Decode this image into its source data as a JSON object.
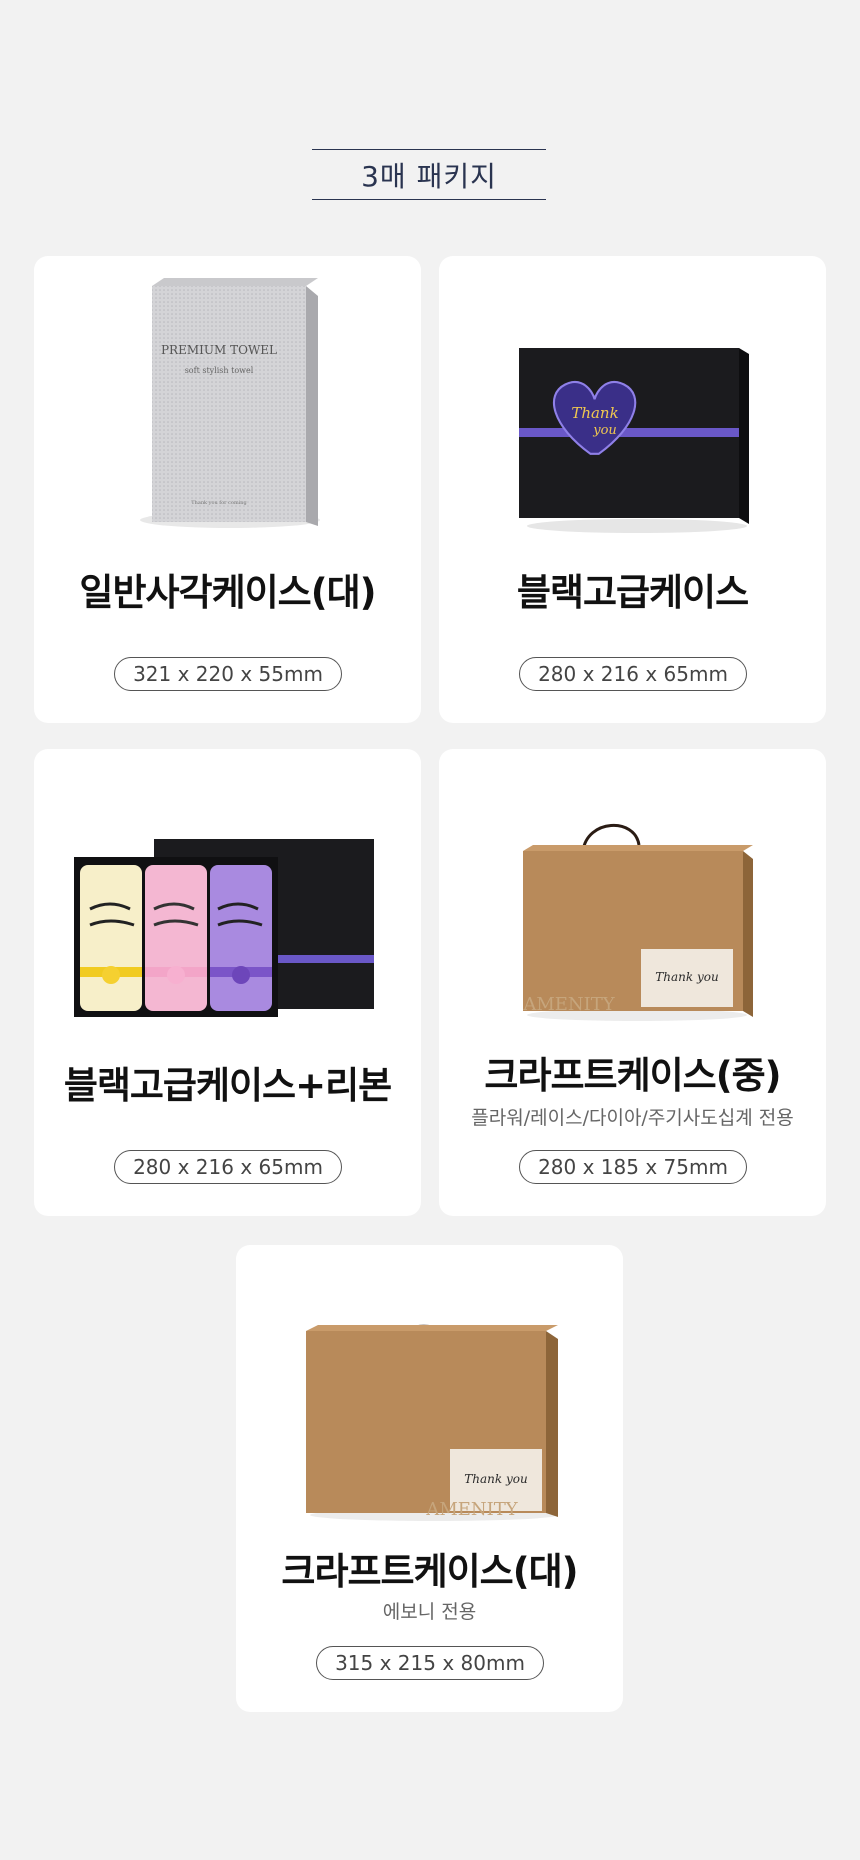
{
  "header": {
    "title": "3매 패키지"
  },
  "cards": [
    {
      "title": "일반사각케이스(대)",
      "subtitle": "",
      "size": "321 x 220 x 55mm",
      "image_text": {
        "line1": "PREMIUM TOWEL",
        "line2": "soft stylish towel",
        "line3": "Thank you for coming"
      }
    },
    {
      "title": "블랙고급케이스",
      "subtitle": "",
      "size": "280 x 216 x 65mm",
      "image_text": {
        "heart_line1": "Thank",
        "heart_line2": "you"
      }
    },
    {
      "title": "블랙고급케이스+리본",
      "subtitle": "",
      "size": "280 x 216 x 65mm"
    },
    {
      "title": "크라프트케이스(중)",
      "subtitle": "플라워/레이스/다이아/주기사도십계 전용",
      "size": "280 x 185 x 75mm",
      "image_text": {
        "card_text": "Thank you",
        "brand": "AMENITY"
      }
    },
    {
      "title": "크라프트케이스(대)",
      "subtitle": "에보니 전용",
      "size": "315 x 215 x 80mm",
      "image_text": {
        "card_text": "Thank you",
        "brand": "AMENITY"
      }
    }
  ],
  "colors": {
    "background": "#f2f2f2",
    "card": "#ffffff",
    "header_line": "#2a3450",
    "kraft": "#b88a5a"
  }
}
